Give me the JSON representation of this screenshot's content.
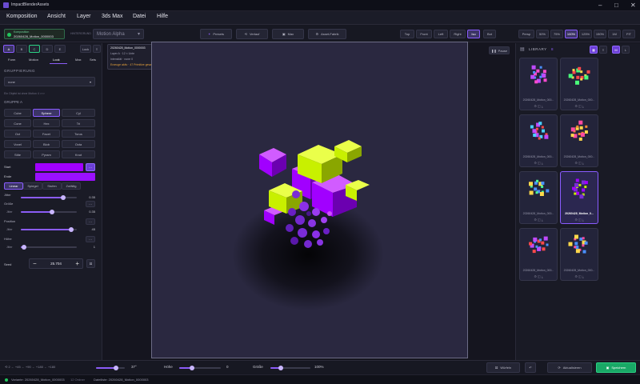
{
  "app": {
    "title": "ImpactBlenderAssets"
  },
  "menu": [
    "Komposition",
    "Ansicht",
    "Layer",
    "3ds Max",
    "Datei",
    "Hilfe"
  ],
  "toolbar": {
    "project_label": "Komposition",
    "project_name": "20260428_Motion_0000003",
    "background_label": "HINTERGRUND",
    "motion_select": "Motion Alpha",
    "modes": [
      "Presets",
      "Verlauf",
      "Max",
      "Asset-Fabrik"
    ],
    "views": [
      "Top",
      "Front",
      "Left",
      "Right",
      "Iso",
      "Bot",
      "Persp"
    ],
    "active_view": "Iso",
    "zoom": [
      "50%",
      "75%",
      "100%",
      "125%",
      "150%"
    ],
    "active_zoom": "100%",
    "size": "1M",
    "fit": "FIT"
  },
  "left": {
    "layers": [
      "A",
      "B",
      "C",
      "D",
      "E",
      "Lock"
    ],
    "tabs": [
      "Form",
      "Motion",
      "Look",
      "Max",
      "Sets"
    ],
    "grouping_header": "GRUPPIERUNG",
    "grouping_value": "none",
    "hint": "Ein Objekt ist ohne Motion 4 >>>",
    "group_header": "GRUPPE A",
    "shapes": [
      "Cube",
      "Sphere",
      "Cyl",
      "Cone",
      "Hex",
      "Tri",
      "Oct",
      "Facet",
      "Torus",
      "Voxel",
      "Blob",
      "Octa",
      "Stite",
      "Pyram",
      "Knot"
    ],
    "active_shape": "Sphere",
    "start_label": "Start",
    "end_label": "Ende",
    "interp": [
      "Linear",
      "Spiegel",
      "Stufen",
      "Zufällig"
    ],
    "active_interp": "Linear",
    "params": [
      {
        "label": "Jitter",
        "sub": "",
        "value": "0.35",
        "fill": 0.75
      },
      {
        "label": "Größe",
        "sub": "Jitter",
        "value": "0.35",
        "fill": 0.55
      },
      {
        "label": "Position",
        "sub": "Jitter",
        "value": "45",
        "fill": 0.9
      },
      {
        "label": "Höhe",
        "sub": "Jitter",
        "value": "1",
        "fill": 0.05
      }
    ],
    "seed_label": "Seed",
    "seed_value": "25.704"
  },
  "viewport": {
    "info_name": "20260428_Motion_0000003",
    "info_layer": "Layer A · 12 × Unte",
    "info_detail": "Intensität · none 0",
    "info_warn": "Erzeuge aktiv · 47 Primitive gesamt",
    "pause": "Pause"
  },
  "library": {
    "title": "LIBRARY",
    "count": "8",
    "items": [
      "20260428_Motion_000...",
      "20260428_Motion_000...",
      "20260428_Motion_000...",
      "20260428_Motion_000...",
      "20260428_Motion_000...",
      "20260428_Motion_0...",
      "20260428_Motion_000...",
      "20260428_Motion_000..."
    ],
    "selected_index": 5
  },
  "bottom": {
    "fov": "37°",
    "hoehe_label": "Höhe",
    "hoehe_value": "0",
    "groesse_label": "Größe",
    "groesse_value": "100%",
    "wuerfeln": "Würfeln",
    "aktualisieren": "Aktualisieren",
    "speichern": "Speichern"
  },
  "status": {
    "variant": "Variante: 20260428_Motion_0000003",
    "count": "12 Ordner",
    "file": "Dateiliste: 20260428_Motion_0000003"
  },
  "colors": {
    "accent": "#8b5cf6",
    "green": "#22c55e",
    "lime": "#c8f000",
    "magenta": "#a100ff",
    "start_color": "#a100ff",
    "end_color": "#9a10ff"
  }
}
